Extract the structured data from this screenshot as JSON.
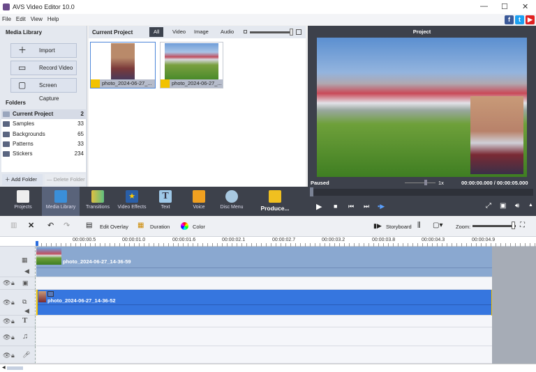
{
  "app": {
    "title": "AVS Video Editor 10.0"
  },
  "menu": [
    "File",
    "Edit",
    "View",
    "Help"
  ],
  "social": [
    "f",
    "t",
    "▶"
  ],
  "left_panel": {
    "title": "Media Library",
    "buttons": [
      "Import",
      "Record Video",
      "Screen Capture"
    ],
    "folders_title": "Folders",
    "folders": [
      {
        "name": "Current Project",
        "count": "2"
      },
      {
        "name": "Samples",
        "count": "33"
      },
      {
        "name": "Backgrounds",
        "count": "65"
      },
      {
        "name": "Patterns",
        "count": "33"
      },
      {
        "name": "Stickers",
        "count": "234"
      }
    ],
    "add_folder": "Add Folder",
    "delete_folder": "Delete Folder"
  },
  "media": {
    "title": "Current Project",
    "tabs": [
      "All",
      "Video",
      "Image",
      "Audio"
    ],
    "items": [
      "photo_2024-06-27_...",
      "photo_2024-06-27_..."
    ]
  },
  "preview": {
    "title": "Project",
    "status": "Paused",
    "speed": "1x",
    "time": "00:00:00.000 / 00:00:05.000"
  },
  "toolbar": [
    "Projects",
    "Media Library",
    "Transitions",
    "Video Effects",
    "Text",
    "Voice",
    "Disc Menu",
    "Produce..."
  ],
  "edit": {
    "overlay": "Edit Overlay",
    "duration": "Duration",
    "color": "Color",
    "storyboard": "Storyboard",
    "zoom": "Zoom:"
  },
  "ruler": [
    "00:00:00.5",
    "00:00:01.0",
    "00:00:01.6",
    "00:00:02.1",
    "00:00:02.7",
    "00:00:03.2",
    "00:00:03.8",
    "00:00:04.3",
    "00:00:04.9"
  ],
  "clips": {
    "video": "photo_2024-06-27_14-36-59",
    "overlay": "photo_2024-06-27_14-36-52"
  }
}
